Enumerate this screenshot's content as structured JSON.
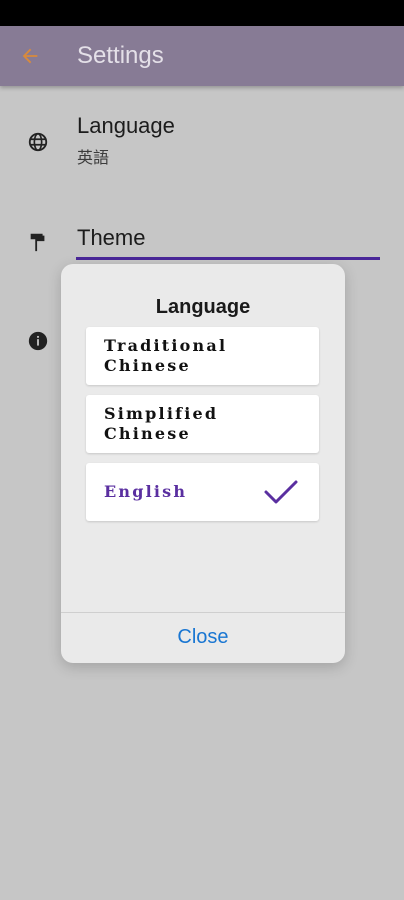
{
  "app_bar": {
    "title": "Settings",
    "back_icon": "arrow-back-icon",
    "back_color": "#d98a3c"
  },
  "settings": {
    "language": {
      "title": "Language",
      "value": "英語",
      "icon": "globe-icon"
    },
    "theme": {
      "title": "Theme",
      "icon": "paint-roller-icon"
    },
    "about": {
      "icon": "info-icon"
    }
  },
  "dialog": {
    "title": "Language",
    "options": [
      {
        "label": "Traditional Chinese",
        "selected": false
      },
      {
        "label": "Simplified Chinese",
        "selected": false
      },
      {
        "label": "English",
        "selected": true
      }
    ],
    "close_label": "Close",
    "accent_color": "#5a2fa0",
    "close_color": "#1976d2"
  }
}
